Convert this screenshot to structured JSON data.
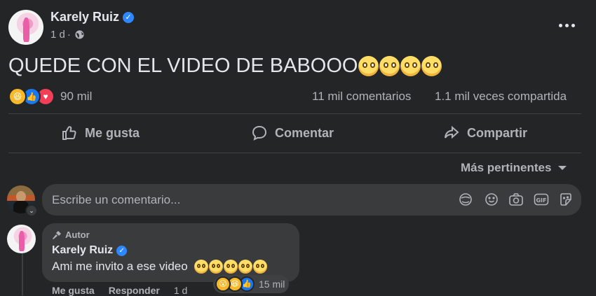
{
  "post": {
    "author": "Karely Ruiz",
    "time": "1 d",
    "dot": "·",
    "text": "QUEDE CON EL VIDEO DE BABOOO",
    "emoji_count": 4
  },
  "stats": {
    "reactions_count": "90 mil",
    "comments": "11 mil comentarios",
    "shares": "1.1 mil veces compartida"
  },
  "actions": {
    "like": "Me gusta",
    "comment": "Comentar",
    "share": "Compartir"
  },
  "sort": {
    "label": "Más pertinentes"
  },
  "composer": {
    "placeholder": "Escribe un comentario..."
  },
  "comment": {
    "badge": "Autor",
    "author": "Karely Ruiz",
    "text": "Ami me invito a ese video",
    "reactions_count": "15 mil",
    "like": "Me gusta",
    "reply": "Responder",
    "time": "1 d"
  },
  "icons": {
    "more": "more-options-icon",
    "globe": "globe-icon",
    "verified": "verified-badge-icon"
  },
  "colors": {
    "background": "#242526",
    "text": "#e4e6eb",
    "secondary": "#b0b3b8",
    "accent": "#2d88ff"
  }
}
